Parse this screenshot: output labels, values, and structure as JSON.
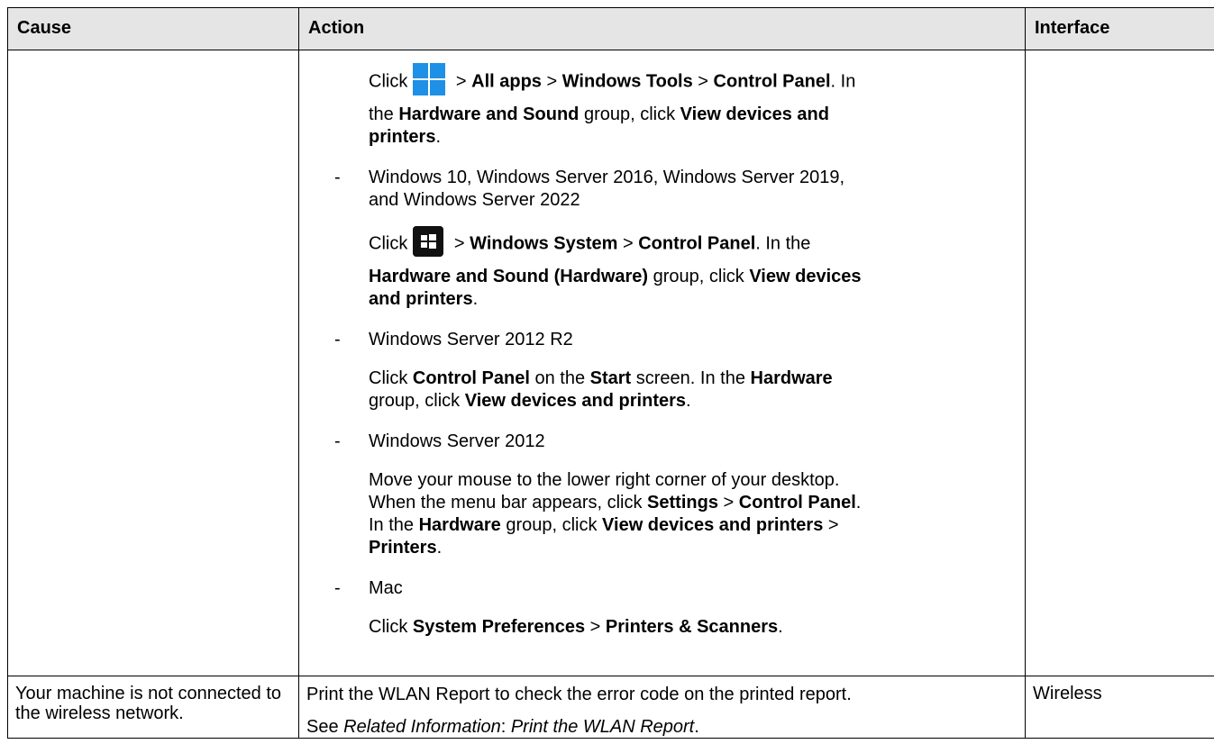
{
  "headers": {
    "cause": "Cause",
    "action": "Action",
    "interface": "Interface"
  },
  "row1": {
    "win11_line1": [
      "Click",
      " > ",
      "All apps",
      " > ",
      "Windows Tools",
      " > ",
      "Control Panel",
      ". In"
    ],
    "win11_line2": [
      "the ",
      "Hardware and Sound",
      " group, click ",
      "View devices and"
    ],
    "win11_line3": [
      "printers",
      "."
    ],
    "dash": "-",
    "win10_title_1": "Windows 10, Windows Server 2016, Windows Server 2019,",
    "win10_title_2": "and Windows Server 2022",
    "win10_line1": [
      "Click",
      " > ",
      "Windows System",
      " > ",
      "Control Panel",
      ". In the"
    ],
    "win10_line2": [
      "Hardware and Sound (Hardware)",
      " group, click ",
      "View devices"
    ],
    "win10_line3": [
      "and printers",
      "."
    ],
    "ws2012r2_title": "Windows Server 2012 R2",
    "ws2012r2_line1": [
      "Click ",
      "Control Panel",
      " on the ",
      "Start",
      " screen. In the ",
      "Hardware"
    ],
    "ws2012r2_line2": [
      "group, click ",
      "View devices and printers",
      "."
    ],
    "ws2012_title": "Windows Server 2012",
    "ws2012_line1": "Move your mouse to the lower right corner of your desktop.",
    "ws2012_line2": [
      "When the menu bar appears, click ",
      "Settings",
      " > ",
      "Control Panel",
      "."
    ],
    "ws2012_line3": [
      "In the ",
      "Hardware",
      " group, click ",
      "View devices and printers",
      " >"
    ],
    "ws2012_line4": [
      "Printers",
      "."
    ],
    "mac_title": "Mac",
    "mac_line1": [
      "Click ",
      "System Preferences",
      " > ",
      "Printers & Scanners",
      "."
    ]
  },
  "row2": {
    "cause": "Your machine is not connected to the wireless network.",
    "action_line1": "Print the WLAN Report to check the error code on the printed report.",
    "action_line2": [
      "See ",
      "Related Information",
      ": ",
      "Print the WLAN Report",
      "."
    ],
    "interface": "Wireless"
  },
  "icons": {
    "win11": "windows-11-start-icon",
    "win10": "windows-10-start-icon",
    "win11_color": "#1e90e6",
    "win10_color": "#111111"
  }
}
